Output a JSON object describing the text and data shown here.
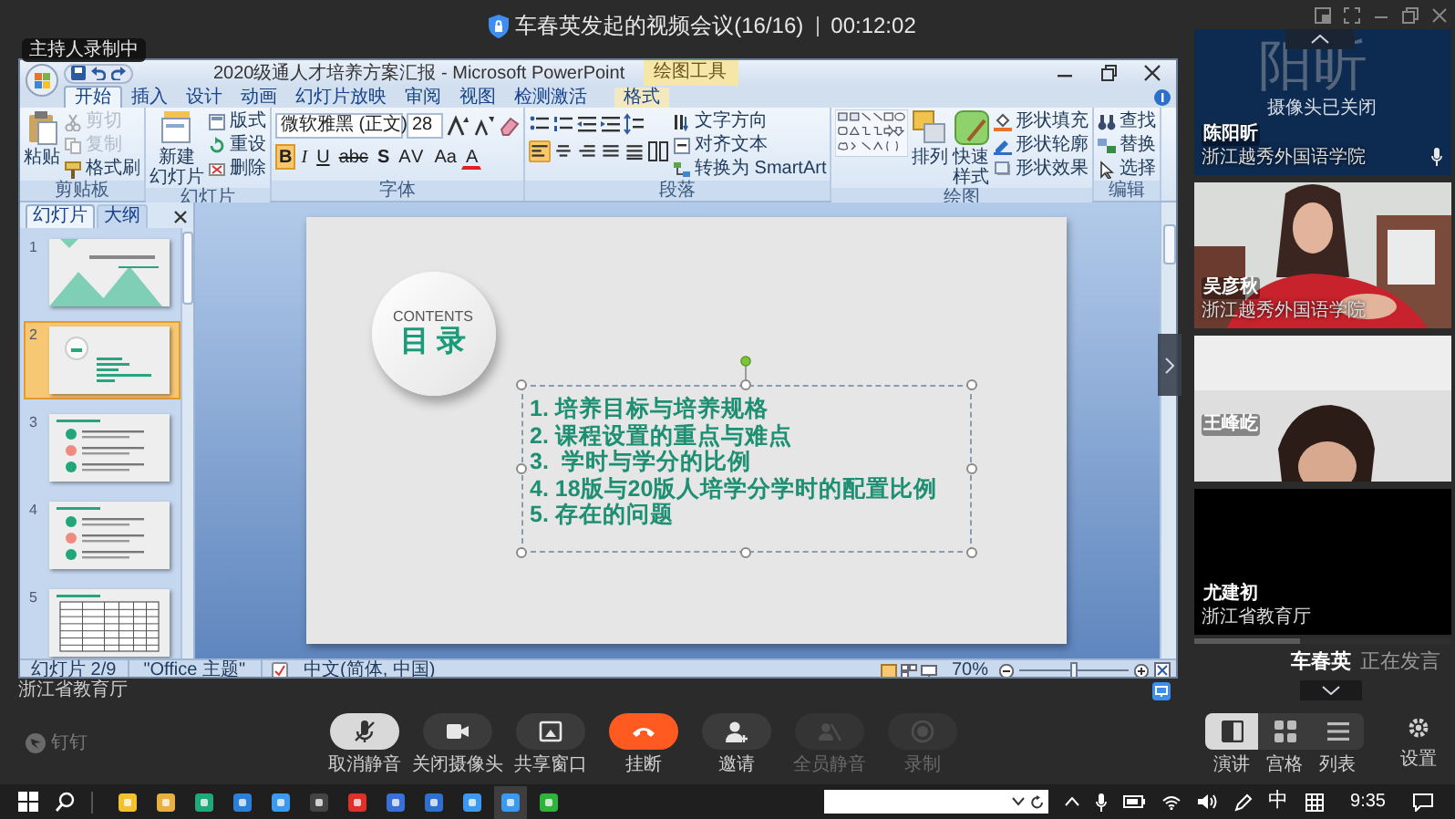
{
  "meeting": {
    "title": "车春英发起的视频会议(16/16)",
    "timer": "00:12:02"
  },
  "recording_badge": "主持人录制中",
  "powerpoint": {
    "title": "2020级通人才培养方案汇报 - Microsoft PowerPoint",
    "context_group": "绘图工具",
    "tabs": [
      {
        "label": "开始",
        "selected": true,
        "contextual": false
      },
      {
        "label": "插入",
        "selected": false,
        "contextual": false
      },
      {
        "label": "设计",
        "selected": false,
        "contextual": false
      },
      {
        "label": "动画",
        "selected": false,
        "contextual": false
      },
      {
        "label": "幻灯片放映",
        "selected": false,
        "contextual": false
      },
      {
        "label": "审阅",
        "selected": false,
        "contextual": false
      },
      {
        "label": "视图",
        "selected": false,
        "contextual": false
      },
      {
        "label": "检测激活",
        "selected": false,
        "contextual": false
      },
      {
        "label": "格式",
        "selected": false,
        "contextual": true
      }
    ],
    "ribbon": [
      {
        "kind": "clipboard",
        "label": "剪贴板",
        "big": [
          [
            "粘贴"
          ]
        ],
        "small": [
          {
            "label": "剪切",
            "disabled": true
          },
          {
            "label": "复制",
            "disabled": true
          },
          {
            "label": "格式刷",
            "disabled": false
          }
        ]
      },
      {
        "kind": "slides",
        "label": "幻灯片",
        "big": [
          [
            "新建",
            "幻灯片"
          ]
        ],
        "small": [
          {
            "label": "版式",
            "disabled": false
          },
          {
            "label": "重设",
            "disabled": false
          },
          {
            "label": "删除",
            "disabled": false
          }
        ]
      },
      {
        "kind": "font",
        "label": "字体",
        "font_name": "微软雅黑 (正文)",
        "font_size": "28",
        "format_buttons": [
          {
            "label": "B",
            "on": true
          },
          {
            "label": "I",
            "on": false
          },
          {
            "label": "U",
            "on": false
          },
          {
            "label": "abc",
            "on": false
          },
          {
            "label": "S",
            "on": false
          },
          {
            "label": "AV",
            "on": false
          },
          {
            "label": "Aa",
            "on": false
          },
          {
            "label": "A",
            "on": false
          }
        ]
      },
      {
        "kind": "paragraph",
        "label": "段落",
        "alignments": [
          {
            "selected": true
          },
          {
            "selected": false
          },
          {
            "selected": false
          },
          {
            "selected": false
          },
          {
            "selected": false
          }
        ],
        "small": [
          {
            "label": "文字方向",
            "disabled": false
          },
          {
            "label": "对齐文本",
            "disabled": false
          },
          {
            "label": "转换为 SmartArt",
            "disabled": false
          }
        ]
      },
      {
        "kind": "drawing",
        "label": "绘图",
        "big": [
          [
            "排列"
          ],
          [
            "快速样式"
          ]
        ],
        "small": [
          {
            "label": "形状填充",
            "disabled": false
          },
          {
            "label": "形状轮廓",
            "disabled": false
          },
          {
            "label": "形状效果",
            "disabled": false
          }
        ]
      },
      {
        "kind": "editing",
        "label": "编辑",
        "small": [
          {
            "label": "查找",
            "disabled": false
          },
          {
            "label": "替换",
            "disabled": false
          },
          {
            "label": "选择",
            "disabled": false
          }
        ]
      }
    ],
    "slides_pane": {
      "tabs": [
        {
          "label": "幻灯片",
          "selected": true
        },
        {
          "label": "大纲",
          "selected": false
        }
      ],
      "thumbnails": [
        {
          "number": "1",
          "kind": "title",
          "selected": false
        },
        {
          "number": "2",
          "kind": "contents",
          "selected": true
        },
        {
          "number": "3",
          "kind": "list",
          "selected": false
        },
        {
          "number": "4",
          "kind": "list",
          "selected": false
        },
        {
          "number": "5",
          "kind": "table",
          "selected": false
        }
      ]
    },
    "slide": {
      "badge_en": "CONTENTS",
      "badge_zh": "目 录",
      "items": [
        "1. 培养目标与培养规格",
        "2. 课程设置的重点与难点",
        "3.  学时与学分的比例",
        "4. 18版与20版人培学分学时的配置比例",
        "5. 存在的问题"
      ]
    },
    "status_bar": {
      "slide": "幻灯片 2/9",
      "theme": "\"Office 主题\"",
      "language": "中文(简体, 中国)",
      "zoom": "70%",
      "zoom_slider": {
        "level": 0.5
      }
    }
  },
  "presenter_org": "浙江省教育厅",
  "participants": [
    {
      "kind": "avatar",
      "avatar_text": "阳昕",
      "camera_status": "摄像头已关闭",
      "name": "陈阳昕",
      "org": "浙江越秀外国语学院"
    },
    {
      "kind": "video",
      "name": "吴彦秋",
      "org": "浙江越秀外国语学院"
    },
    {
      "kind": "video",
      "name": "王峰屹"
    },
    {
      "kind": "blank",
      "name": "尤建初",
      "org": "浙江省教育厅"
    }
  ],
  "speaker": {
    "name": "车春英",
    "status": "正在发言"
  },
  "toolbar": {
    "logo": "钉钉",
    "buttons": [
      {
        "kind": "mic",
        "label": "取消静音",
        "highlighted": true,
        "disabled": false
      },
      {
        "kind": "camera",
        "label": "关闭摄像头",
        "highlighted": false,
        "disabled": false
      },
      {
        "kind": "share",
        "label": "共享窗口",
        "highlighted": false,
        "disabled": false
      },
      {
        "kind": "hangup",
        "label": "挂断",
        "highlighted": false,
        "disabled": false
      },
      {
        "kind": "invite",
        "label": "邀请",
        "highlighted": false,
        "disabled": false
      },
      {
        "kind": "muteall",
        "label": "全员静音",
        "highlighted": false,
        "disabled": true
      },
      {
        "kind": "record",
        "label": "录制",
        "highlighted": false,
        "disabled": true
      }
    ],
    "layouts": [
      {
        "label": "演讲",
        "selected": true
      },
      {
        "label": "宫格",
        "selected": false
      },
      {
        "label": "列表",
        "selected": false
      }
    ],
    "settings": "设置"
  },
  "taskbar": {
    "ime": "中",
    "time": "9:35"
  }
}
